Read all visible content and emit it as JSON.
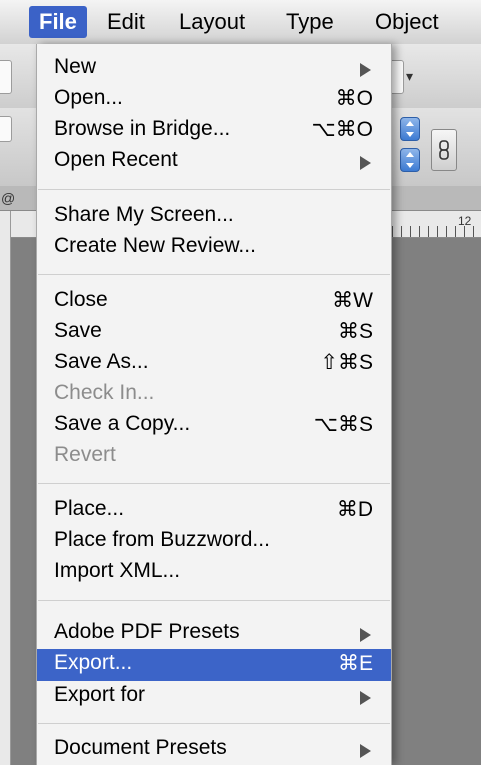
{
  "menubar": {
    "items": [
      {
        "label": "File",
        "active": true
      },
      {
        "label": "Edit"
      },
      {
        "label": "Layout"
      },
      {
        "label": "Type"
      },
      {
        "label": "Object"
      }
    ]
  },
  "ruler": {
    "number": "12"
  },
  "background": {
    "at_sign": "@",
    "link_icon": "chain-link-icon"
  },
  "menu": {
    "items": [
      {
        "label": "New",
        "shortcut": "",
        "submenu": true
      },
      {
        "label": "Open...",
        "shortcut": "⌘O"
      },
      {
        "label": "Browse in Bridge...",
        "shortcut": "⌥⌘O"
      },
      {
        "label": "Open Recent",
        "shortcut": "",
        "submenu": true
      },
      {
        "label": "Share My Screen...",
        "shortcut": ""
      },
      {
        "label": "Create New Review...",
        "shortcut": ""
      },
      {
        "label": "Close",
        "shortcut": "⌘W"
      },
      {
        "label": "Save",
        "shortcut": "⌘S"
      },
      {
        "label": "Save As...",
        "shortcut": "⇧⌘S"
      },
      {
        "label": "Check In...",
        "shortcut": "",
        "disabled": true
      },
      {
        "label": "Save a Copy...",
        "shortcut": "⌥⌘S"
      },
      {
        "label": "Revert",
        "shortcut": "",
        "disabled": true
      },
      {
        "label": "Place...",
        "shortcut": "⌘D"
      },
      {
        "label": "Place from Buzzword...",
        "shortcut": ""
      },
      {
        "label": "Import XML...",
        "shortcut": ""
      },
      {
        "label": "Adobe PDF Presets",
        "shortcut": "",
        "submenu": true
      },
      {
        "label": "Export...",
        "shortcut": "⌘E",
        "highlighted": true
      },
      {
        "label": "Export for",
        "shortcut": "",
        "submenu": true
      },
      {
        "label": "Document Presets",
        "shortcut": "",
        "submenu": true
      }
    ]
  },
  "colors": {
    "highlight": "#3c64c8",
    "menu_bg": "#f3f3f3",
    "disabled_text": "#8c8c8c"
  }
}
